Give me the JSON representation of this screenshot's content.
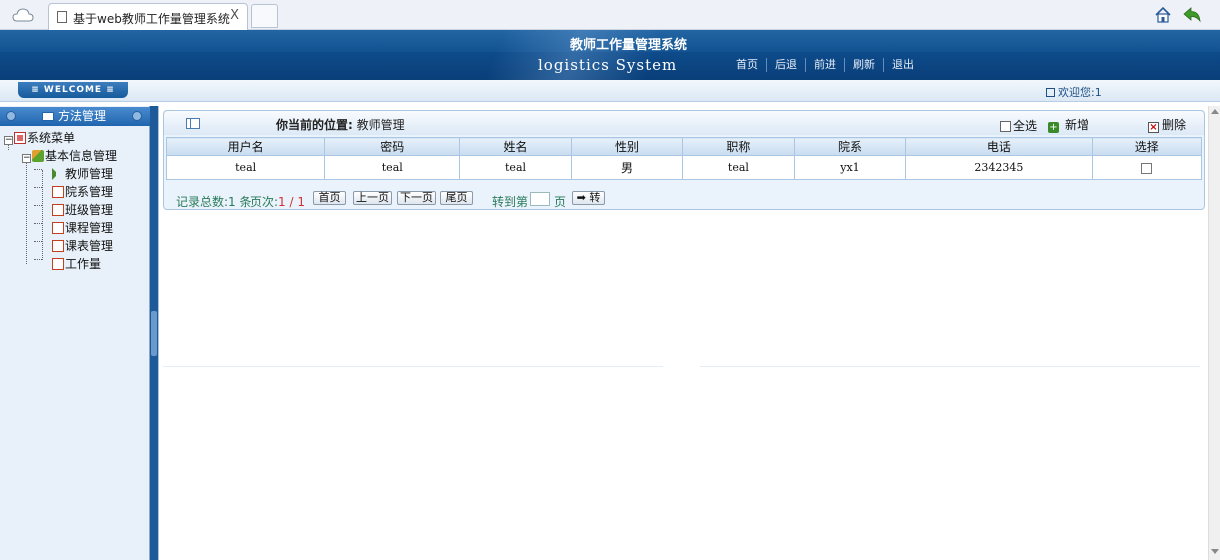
{
  "browser": {
    "tab_title": "基于web教师工作量管理系统",
    "tab_close": "X"
  },
  "header": {
    "title": "教师工作量管理系统",
    "subtitle": "logistics System",
    "nav": [
      "首页",
      "后退",
      "前进",
      "刷新",
      "退出"
    ]
  },
  "welcome": {
    "banner": "≡ WELCOME ≡",
    "user_text": "欢迎您:1"
  },
  "sidebar": {
    "header_label": "方法管理",
    "root": "系统菜单",
    "group": "基本信息管理",
    "items": [
      "教师管理",
      "院系管理",
      "班级管理",
      "课程管理",
      "课表管理",
      "工作量"
    ]
  },
  "main": {
    "location_label": "你当前的位置:",
    "location_value": "教师管理",
    "select_all": "全选",
    "add": "新增",
    "delete": "删除",
    "columns": [
      "用户名",
      "密码",
      "姓名",
      "性别",
      "职称",
      "院系",
      "电话",
      "选择"
    ],
    "rows": [
      [
        "teal",
        "teal",
        "teal",
        "男",
        "teal",
        "yx1",
        "2342345"
      ]
    ],
    "pager": {
      "total_label": "记录总数:",
      "total_value": "1",
      "total_unit": "条",
      "page_label": "页次:",
      "page_value": "1 / 1",
      "first": "首页",
      "prev": "上一页",
      "next": "下一页",
      "last": "尾页",
      "goto_label": "转到第",
      "goto_unit": "页",
      "go": "➡ 转"
    }
  }
}
